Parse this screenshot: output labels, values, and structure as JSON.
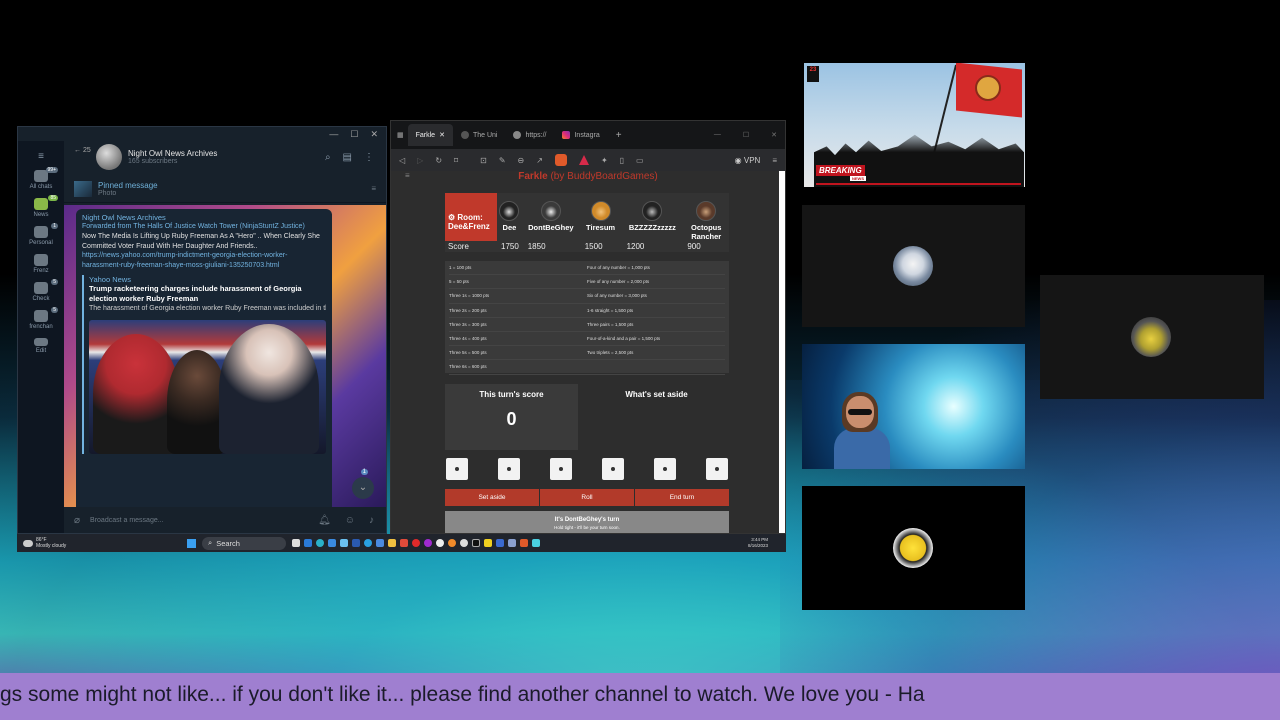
{
  "telegram": {
    "unread_back": "25",
    "channel_name": "Night Owl News Archives",
    "subscribers": "165 subscribers",
    "pinned_title": "Pinned message",
    "pinned_sub": "Photo",
    "rail": [
      {
        "label": "All chats",
        "badge": "99+"
      },
      {
        "label": "News",
        "badge": "85"
      },
      {
        "label": "Personal",
        "badge": "1"
      },
      {
        "label": "Frenz",
        "badge": ""
      },
      {
        "label": "Check",
        "badge": "5"
      },
      {
        "label": "frenchan",
        "badge": "5"
      },
      {
        "label": "Edit",
        "badge": ""
      }
    ],
    "message": {
      "author": "Night Owl News Archives",
      "forwarded": "Forwarded from The Halls Of Justice Watch Tower (NinjaStuntZ Justice)",
      "text": "Now The Media Is Lifting Up Ruby Freeman As A \"Hero\" .. When Clearly She Committed Voter Fraud With Her Daughter And Friends..",
      "link": "https://news.yahoo.com/trump-indictment-georgia-election-worker-harassment-ruby-freeman-shaye-moss-giuliani-135250703.html",
      "preview_site": "Yahoo News",
      "preview_title": "Trump racketeering charges include harassment of Georgia election worker Ruby Freeman",
      "preview_desc": "The harassment of Georgia election worker Ruby Freeman was included in the racketeering charge against former President Do..."
    },
    "scroll_unread": "1",
    "composer_placeholder": "Broadcast a message..."
  },
  "browser": {
    "tabs": [
      {
        "label": "Farkle",
        "active": true
      },
      {
        "label": "The Uni",
        "active": false
      },
      {
        "label": "https://",
        "active": false
      },
      {
        "label": "Instagra",
        "active": false
      }
    ],
    "vpn_label": "VPN",
    "page": {
      "title": "Farkle",
      "brand": " (by BuddyBoardGames)",
      "room_label": "Room:",
      "room_name": "Dee&Frenz",
      "score_label": "Score",
      "players": [
        {
          "name": "Dee",
          "score": "1750",
          "color": "#2a2a2a"
        },
        {
          "name": "DontBeGhey",
          "score": "1850",
          "color": "#3a3a3a"
        },
        {
          "name": "Tiresum",
          "score": "1500",
          "color": "#d08a2a"
        },
        {
          "name": "BZZZZZzzzzz",
          "score": "1200",
          "color": "#222222"
        },
        {
          "name": "Octopus Rancher",
          "score": "900",
          "color": "#5a3a2a"
        }
      ],
      "rules": [
        "1 = 100 pts",
        "Four of any number = 1,000 pts",
        "5 = 50 pts",
        "Five of any number = 2,000 pts",
        "Three 1s = 1000 pts",
        "Six of any number = 3,000 pts",
        "Three 2s = 200 pts",
        "1-6 straight = 1,500 pts",
        "Three 3s = 300 pts",
        "Three pairs = 1,500 pts",
        "Three 4s = 400 pts",
        "Four-of-a-kind and a pair = 1,500 pts",
        "Three 5s = 500 pts",
        "Two triplets = 2,500 pts",
        "Three 6s = 600 pts",
        ""
      ],
      "turn_score_label": "This turn's score",
      "turn_score": "0",
      "set_aside_label": "What's set aside",
      "dice_count": 6,
      "btn_set_aside": "Set aside",
      "btn_roll": "Roll",
      "btn_end_turn": "End turn",
      "turn_banner": "It's DontBeGhey's turn",
      "turn_banner_sub": "Hold tight - it'll be your turn soon."
    }
  },
  "taskbar": {
    "weather_temp": "86°F",
    "weather_desc": "Mostly cloudy",
    "search_label": "Search",
    "time": "3:44 PM",
    "date": "8/16/2023"
  },
  "news_tile": {
    "channel_logo": "23",
    "breaking_label": "BREAKING",
    "breaking_sub": "NEWS"
  },
  "ticker_text": "gs some might not like... if you don't like it... please find another channel to watch. We love you - Ha"
}
